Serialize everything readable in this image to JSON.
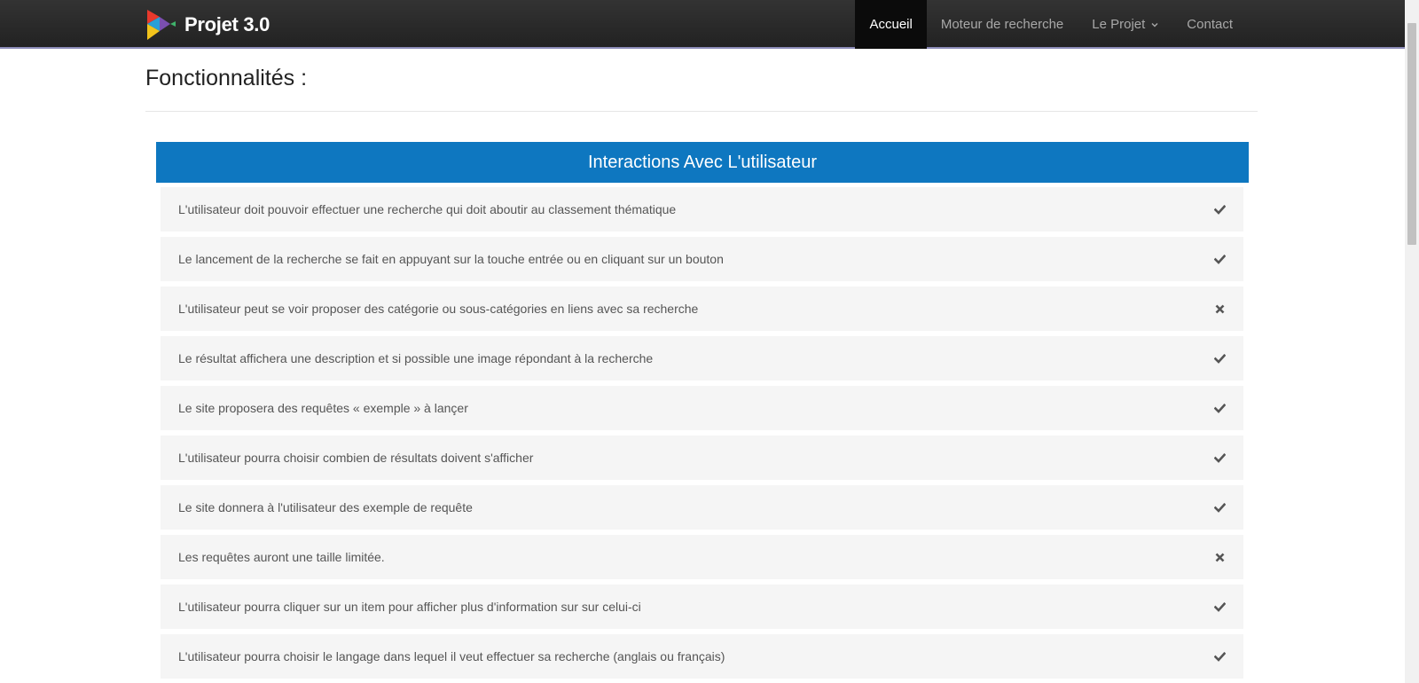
{
  "header": {
    "brand": "Projet 3.0",
    "nav": [
      {
        "label": "Accueil",
        "active": true
      },
      {
        "label": "Moteur de recherche",
        "active": false
      },
      {
        "label": "Le Projet",
        "active": false
      },
      {
        "label": "Contact",
        "active": false
      }
    ]
  },
  "main": {
    "title": "Fonctionnalités :",
    "panel": {
      "title": "Interactions Avec L'utilisateur",
      "rows": [
        {
          "text": "L'utilisateur doit pouvoir effectuer une recherche qui doit aboutir au classement thématique",
          "status": "check"
        },
        {
          "text": "Le lancement de la recherche se fait en appuyant sur la touche entrée ou en cliquant sur un bouton",
          "status": "check"
        },
        {
          "text": "L'utilisateur peut se voir proposer des catégorie ou sous-catégories en liens avec sa recherche",
          "status": "cross"
        },
        {
          "text": "Le résultat affichera une description et si possible une image répondant à la recherche",
          "status": "check"
        },
        {
          "text": "Le site proposera des requêtes « exemple » à lançer",
          "status": "check"
        },
        {
          "text": "L'utilisateur pourra choisir combien de résultats doivent s'afficher",
          "status": "check"
        },
        {
          "text": "Le site donnera à l'utilisateur des exemple de requête",
          "status": "check"
        },
        {
          "text": "Les requêtes auront une taille limitée.",
          "status": "cross"
        },
        {
          "text": "L'utilisateur pourra cliquer sur un item pour afficher plus d'information sur sur celui-ci",
          "status": "check"
        },
        {
          "text": "L'utilisateur pourra choisir le langage dans lequel il veut effectuer sa recherche (anglais ou français)",
          "status": "check"
        }
      ]
    }
  },
  "colors": {
    "panel_header": "#0e77c0",
    "navbar": "#2b2b2b",
    "row_bg": "#f5f5f5"
  }
}
